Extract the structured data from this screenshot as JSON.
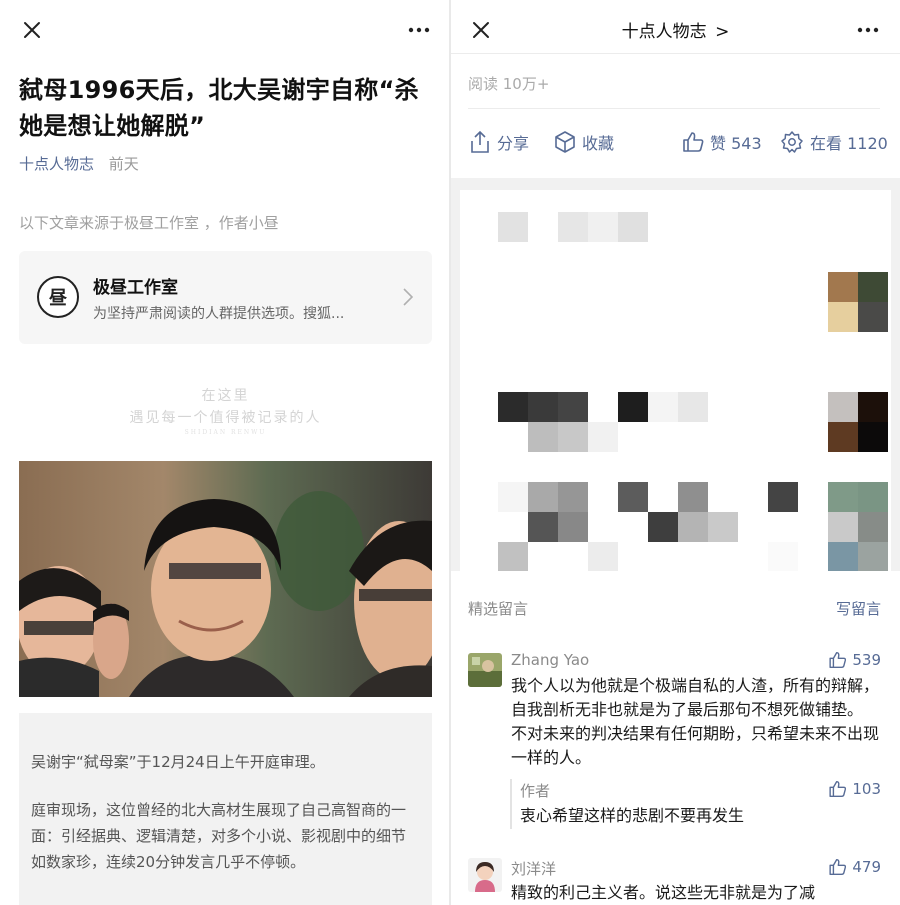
{
  "left": {
    "title": "弑母1996天后，北大吴谢宇自称“杀她是想让她解脱”",
    "account": "十点人物志",
    "time": "前天",
    "source_note": "以下文章来源于极昼工作室 ，作者小昼",
    "card": {
      "name": "极昼工作室",
      "desc": "为坚持严肃阅读的人群提供选项。搜狐...",
      "logo_char": "昼"
    },
    "banner": {
      "line1": "在这里",
      "line2": "遇见每一个值得被记录的人",
      "line3": "SHIDIAN RENWU"
    },
    "paragraphs": [
      "吴谢宇“弑母案”于12月24日上午开庭审理。",
      "庭审现场，这位曾经的北大高材生展现了自己高智商的一面：引经据典、逻辑清楚，对多个小说、影视剧中的细节如数家珍，连续20分钟发言几乎不停顿。"
    ]
  },
  "right": {
    "account": "十点人物志",
    "chevron": ">",
    "reads": "阅读 10万+",
    "actions": {
      "share": "分享",
      "favorite": "收藏",
      "like": "赞 543",
      "looking": "在看 1120"
    },
    "comments_header": "精选留言",
    "write_comment": "写留言",
    "comments": [
      {
        "name": "Zhang Yao",
        "likes": "539",
        "text": "我个人以为他就是个极端自私的人渣，所有的辩解，自我剖析无非也就是为了最后那句不想死做铺垫。 不对未来的判决结果有任何期盼，只希望未来不出现一样的人。",
        "reply": {
          "name": "作者",
          "likes": "103",
          "text": "衷心希望这样的悲剧不要再发生"
        }
      },
      {
        "name": "刘洋洋",
        "likes": "479",
        "text": "精致的利己主义者。说这些无非就是为了减"
      }
    ]
  },
  "colors": {
    "link": "#576b95",
    "meta_gray": "#9a9a9a",
    "quote_bg": "#f2f2f2"
  },
  "icons": [
    "close-icon",
    "more-icon",
    "chevron-right-icon",
    "share-icon",
    "favorite-icon",
    "thumb-up-icon",
    "looking-icon"
  ]
}
